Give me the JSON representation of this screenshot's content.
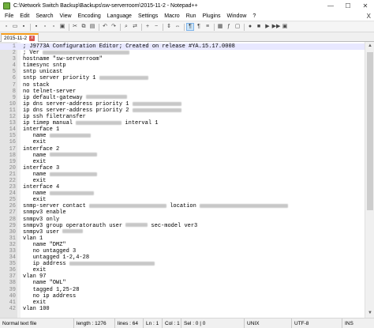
{
  "window": {
    "title": "C:\\Network Switch Backup\\Backups\\sw-serverroom\\2015-11-2 - Notepad++",
    "minimize": "—",
    "maximize": "☐",
    "close": "✕"
  },
  "menu": [
    "File",
    "Edit",
    "Search",
    "View",
    "Encoding",
    "Language",
    "Settings",
    "Macro",
    "Run",
    "Plugins",
    "Window",
    "?"
  ],
  "menu_close": "X",
  "toolbar": {
    "icons": [
      "new-file-icon",
      "open-file-icon",
      "save-icon",
      "save-all-icon",
      "close-icon",
      "close-all-icon",
      "print-icon",
      "cut-icon",
      "copy-icon",
      "paste-icon",
      "undo-icon",
      "redo-icon",
      "find-icon",
      "replace-icon",
      "zoom-in-icon",
      "zoom-out-icon",
      "sync-vertical-icon",
      "sync-horizontal-icon",
      "word-wrap-icon",
      "all-chars-icon",
      "indent-guide-icon",
      "doc-map-icon",
      "function-list-icon",
      "folder-workspace-icon",
      "record-macro-icon",
      "stop-macro-icon",
      "play-macro-icon",
      "run-macro-icon",
      "save-macro-icon"
    ],
    "glyphs": [
      "▫",
      "▭",
      "▪",
      "▪",
      "▫",
      "▫",
      "▣",
      "✂",
      "⧉",
      "▤",
      "↶",
      "↷",
      "⌕",
      "⇄",
      "+",
      "−",
      "⇕",
      "⇔",
      "¶",
      "¶",
      "≡",
      "▦",
      "ƒ",
      "▢",
      "●",
      "■",
      "▶",
      "▶▶",
      "▣"
    ]
  },
  "tab": {
    "label": "2015-11-2",
    "close": "x"
  },
  "editor": {
    "current_line": 1,
    "lines": [
      {
        "n": "1",
        "text": "; J9773A Configuration Editor; Created on release #YA.15.17.0008",
        "redact": 0
      },
      {
        "n": "2",
        "text": "; Ver ",
        "redact": 110
      },
      {
        "n": "3",
        "text": "hostname \"sw-serverroom\"",
        "redact": 0
      },
      {
        "n": "4",
        "text": "timesync sntp",
        "redact": 0
      },
      {
        "n": "5",
        "text": "sntp unicast",
        "redact": 0
      },
      {
        "n": "6",
        "text": "sntp server priority 1 ",
        "redact": 62
      },
      {
        "n": "7",
        "text": "no stack",
        "redact": 0
      },
      {
        "n": "8",
        "text": "no telnet-server",
        "redact": 0
      },
      {
        "n": "9",
        "text": "ip default-gateway ",
        "redact": 52
      },
      {
        "n": "10",
        "text": "ip dns server-address priority 1 ",
        "redact": 62
      },
      {
        "n": "11",
        "text": "ip dns server-address priority 2 ",
        "redact": 62
      },
      {
        "n": "12",
        "text": "ip ssh filetransfer",
        "redact": 0
      },
      {
        "n": "13",
        "text": "ip timep manual ",
        "redact": 58,
        "after": " interval 1"
      },
      {
        "n": "14",
        "text": "interface 1",
        "redact": 0
      },
      {
        "n": "15",
        "text": "   name ",
        "redact": 52
      },
      {
        "n": "16",
        "text": "   exit",
        "redact": 0
      },
      {
        "n": "17",
        "text": "interface 2",
        "redact": 0
      },
      {
        "n": "18",
        "text": "   name ",
        "redact": 60
      },
      {
        "n": "19",
        "text": "   exit",
        "redact": 0
      },
      {
        "n": "20",
        "text": "interface 3",
        "redact": 0
      },
      {
        "n": "21",
        "text": "   name ",
        "redact": 60
      },
      {
        "n": "22",
        "text": "   exit",
        "redact": 0
      },
      {
        "n": "23",
        "text": "interface 4",
        "redact": 0
      },
      {
        "n": "24",
        "text": "   name ",
        "redact": 56
      },
      {
        "n": "25",
        "text": "   exit",
        "redact": 0
      },
      {
        "n": "26",
        "text": "snmp-server contact ",
        "redact": 98,
        "after": " location ",
        "redact2": 112
      },
      {
        "n": "27",
        "text": "snmpv3 enable",
        "redact": 0
      },
      {
        "n": "28",
        "text": "snmpv3 only",
        "redact": 0
      },
      {
        "n": "29",
        "text": "snmpv3 group operatorauth user ",
        "redact": 28,
        "after": " sec-model ver3"
      },
      {
        "n": "30",
        "text": "snmpv3 user ",
        "redact": 26
      },
      {
        "n": "31",
        "text": "vlan 1",
        "redact": 0
      },
      {
        "n": "32",
        "text": "   name \"DMZ\"",
        "redact": 0
      },
      {
        "n": "33",
        "text": "   no untagged 3",
        "redact": 0
      },
      {
        "n": "34",
        "text": "   untagged 1-2,4-28",
        "redact": 0
      },
      {
        "n": "35",
        "text": "   ip address ",
        "redact": 108
      },
      {
        "n": "36",
        "text": "   exit",
        "redact": 0
      },
      {
        "n": "37",
        "text": "vlan 97",
        "redact": 0
      },
      {
        "n": "38",
        "text": "   name \"OWL\"",
        "redact": 0
      },
      {
        "n": "39",
        "text": "   tagged 1,25-28",
        "redact": 0
      },
      {
        "n": "40",
        "text": "   no ip address",
        "redact": 0
      },
      {
        "n": "41",
        "text": "   exit",
        "redact": 0
      },
      {
        "n": "42",
        "text": "vlan 100",
        "redact": 0
      }
    ]
  },
  "scrollbar": {
    "up": "▲",
    "down": "▼",
    "position": 0.0
  },
  "status": {
    "file_type": "Normal text file",
    "length": "length : 1276",
    "lines": "lines : 64",
    "ln": "Ln : 1",
    "col": "Col : 1",
    "sel": "Sel : 0 | 0",
    "eol": "UNIX",
    "encoding": "UTF-8",
    "mode": "INS"
  }
}
